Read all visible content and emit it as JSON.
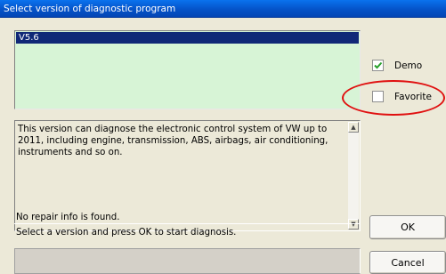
{
  "window": {
    "title": "Select version of diagnostic program"
  },
  "versions": {
    "items": [
      {
        "label": "V5.6",
        "selected": true
      }
    ]
  },
  "description": {
    "text": "This version can diagnose the electronic control system of VW up to 2011, including engine, transmission, ABS, airbags, air conditioning, instruments and so on."
  },
  "status": {
    "repair_info": "No repair info is found.",
    "hint": "Select a version and press OK to start diagnosis."
  },
  "options": {
    "demo": {
      "label": "Demo",
      "checked": true
    },
    "favorite": {
      "label": "Favorite",
      "checked": false
    }
  },
  "buttons": {
    "ok": "OK",
    "cancel": "Cancel"
  },
  "colors": {
    "title_bar": "#0553c9",
    "list_background": "#d7f4d6",
    "selection": "#102877",
    "highlight_circle": "#e01010",
    "checkmark": "#27a02a"
  },
  "scrollbar": {
    "up_icon": "arrow-up-icon",
    "down_icon": "arrow-down-icon"
  }
}
